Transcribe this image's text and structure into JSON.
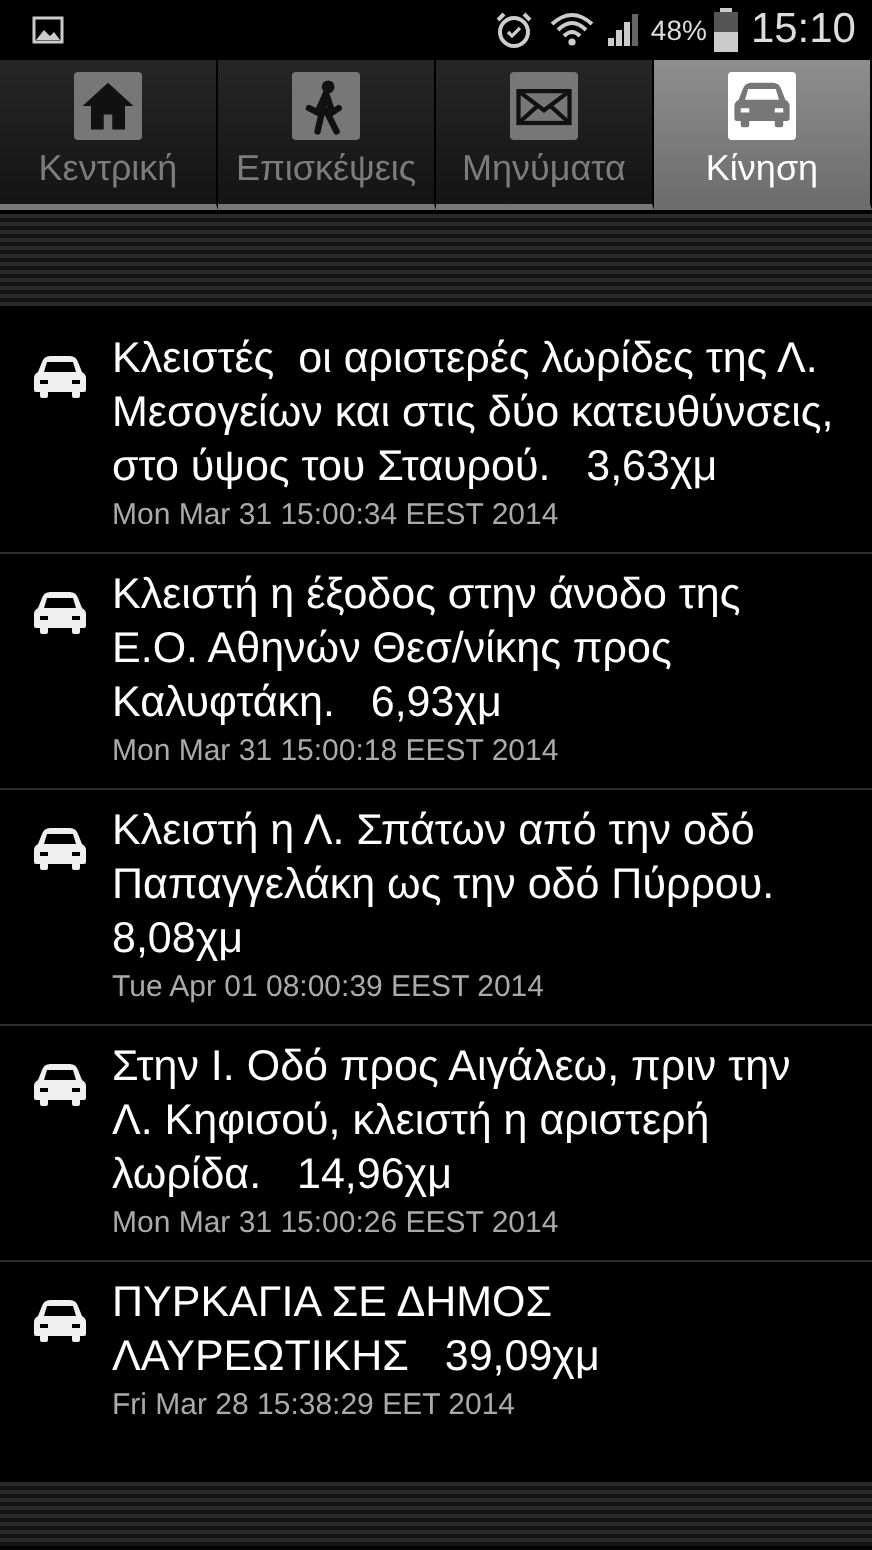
{
  "status_bar": {
    "battery_percent": "48%",
    "time": "15:10"
  },
  "tabs": [
    {
      "label": "Κεντρική",
      "kind": "home",
      "selected": false
    },
    {
      "label": "Επισκέψεις",
      "kind": "walk",
      "selected": false
    },
    {
      "label": "Μηνύματα",
      "kind": "mail",
      "selected": false
    },
    {
      "label": "Κίνηση",
      "kind": "car",
      "selected": true
    }
  ],
  "items": [
    {
      "text": "Κλειστές  οι αριστερές λωρίδες της Λ. Μεσογείων και στις δύο κατευθύνσεις, στο ύψος του Σταυρού.   3,63χμ",
      "date": "Mon Mar 31 15:00:34 EEST 2014"
    },
    {
      "text": "Κλειστή η έξοδος στην άνοδο της Ε.Ο. Αθηνών Θεσ/νίκης προς Καλυφτάκη.   6,93χμ",
      "date": "Mon Mar 31 15:00:18 EEST 2014"
    },
    {
      "text": "Κλειστή η Λ. Σπάτων από την οδό Παπαγγελάκη ως την οδό Πύρρου.   8,08χμ",
      "date": "Tue Apr 01 08:00:39 EEST 2014"
    },
    {
      "text": "Στην Ι. Οδό προς Αιγάλεω, πριν την Λ. Κηφισού, κλειστή η αριστερή λωρίδα.   14,96χμ",
      "date": "Mon Mar 31 15:00:26 EEST 2014"
    },
    {
      "text": "ΠΥΡΚΑΓΙΑ ΣΕ ΔΗΜΟΣ ΛΑΥΡΕΩΤΙΚΗΣ   39,09χμ",
      "date": "Fri Mar 28 15:38:29 EET 2014"
    }
  ]
}
